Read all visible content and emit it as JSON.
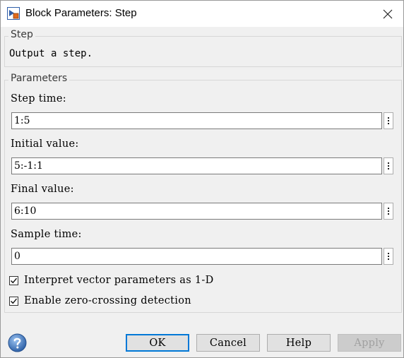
{
  "window": {
    "title": "Block Parameters: Step",
    "icon": "simulink-block-icon",
    "close_icon": "close-icon"
  },
  "description_group": {
    "title": "Step",
    "text": "Output a step."
  },
  "parameters_group": {
    "title": "Parameters",
    "fields": [
      {
        "label": "Step time:",
        "value": "1:5"
      },
      {
        "label": "Initial value:",
        "value": "5:-1:1"
      },
      {
        "label": "Final value:",
        "value": "6:10"
      },
      {
        "label": "Sample time:",
        "value": "0"
      }
    ],
    "checkboxes": [
      {
        "label": "Interpret vector parameters as 1-D",
        "checked": true
      },
      {
        "label": "Enable zero-crossing detection",
        "checked": true
      }
    ]
  },
  "buttons": {
    "ok": "OK",
    "cancel": "Cancel",
    "help": "Help",
    "apply": "Apply"
  },
  "colors": {
    "accent": "#0078d7",
    "dialog_bg": "#f0f0f0",
    "help_icon": "#3b6fb6"
  }
}
